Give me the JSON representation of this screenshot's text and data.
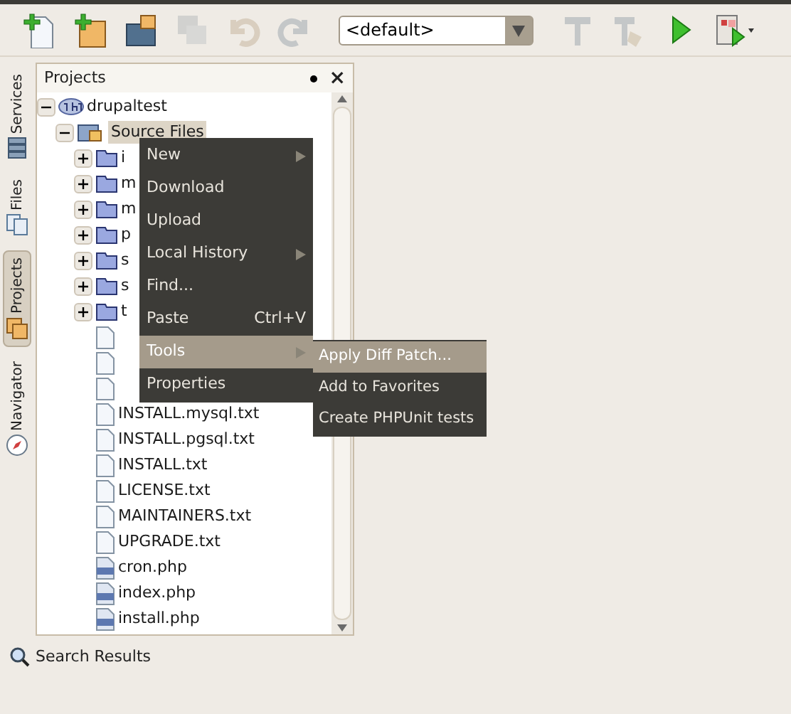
{
  "toolbar": [
    {
      "kind": "new-file",
      "disabled": false
    },
    {
      "kind": "new-project",
      "disabled": false
    },
    {
      "kind": "open-project",
      "disabled": false
    },
    {
      "kind": "save-all",
      "disabled": true
    },
    {
      "kind": "undo",
      "disabled": true
    },
    {
      "kind": "redo",
      "disabled": true
    },
    {
      "kind": "config",
      "value": "<default>"
    },
    {
      "kind": "build",
      "disabled": true
    },
    {
      "kind": "clean-build",
      "disabled": true
    },
    {
      "kind": "run",
      "disabled": false
    },
    {
      "kind": "test",
      "disabled": false
    }
  ],
  "side_tabs": [
    {
      "label": "Services",
      "kind": "services",
      "selected": false
    },
    {
      "label": "Files",
      "kind": "files",
      "selected": false
    },
    {
      "label": "Projects",
      "kind": "projects",
      "selected": true
    },
    {
      "label": "Navigator",
      "kind": "navigator",
      "selected": false
    }
  ],
  "projects": {
    "title": "Projects",
    "close": "×",
    "tree": [
      {
        "label": "drupaltest",
        "kind": "project",
        "expanded": true,
        "children": [
          {
            "label": "Source Files",
            "kind": "source",
            "expanded": true,
            "selected": true,
            "children": [
              {
                "label": "i",
                "kind": "folder",
                "expanded": false
              },
              {
                "label": "m",
                "kind": "folder",
                "expanded": false
              },
              {
                "label": "m",
                "kind": "folder",
                "expanded": false
              },
              {
                "label": "p",
                "kind": "folder",
                "expanded": false
              },
              {
                "label": "s",
                "kind": "folder",
                "expanded": false
              },
              {
                "label": "s",
                "kind": "folder",
                "expanded": false
              },
              {
                "label": "t",
                "kind": "folder",
                "expanded": false
              },
              {
                "kind": "text"
              },
              {
                "kind": "text"
              },
              {
                "kind": "text"
              },
              {
                "label": "INSTALL.mysql.txt",
                "kind": "text"
              },
              {
                "label": "INSTALL.pgsql.txt",
                "kind": "text"
              },
              {
                "label": "INSTALL.txt",
                "kind": "text"
              },
              {
                "label": "LICENSE.txt",
                "kind": "text"
              },
              {
                "label": "MAINTAINERS.txt",
                "kind": "text"
              },
              {
                "label": "UPGRADE.txt",
                "kind": "text"
              },
              {
                "label": "cron.php",
                "kind": "php"
              },
              {
                "label": "index.php",
                "kind": "php"
              },
              {
                "label": "install.php",
                "kind": "php"
              }
            ]
          }
        ]
      }
    ]
  },
  "context_menu": [
    {
      "label": "New",
      "submenu": true,
      "selected": false
    },
    {
      "label": "Download",
      "submenu": false,
      "selected": false
    },
    {
      "label": "Upload",
      "submenu": false,
      "selected": false
    },
    {
      "label": "Local History",
      "submenu": true,
      "selected": false
    },
    {
      "label": "Find...",
      "submenu": false,
      "selected": false
    },
    {
      "label": "Paste",
      "shortcut": "Ctrl+V",
      "submenu": false,
      "selected": false
    },
    {
      "label": "Tools",
      "submenu": true,
      "selected": true
    },
    {
      "label": "Properties",
      "submenu": false,
      "selected": false
    }
  ],
  "submenu": [
    {
      "label": "Apply Diff Patch...",
      "selected": true
    },
    {
      "label": "Add to Favorites",
      "selected": false
    },
    {
      "label": "Create PHPUnit tests",
      "selected": false
    }
  ],
  "bottom_tab": {
    "label": "Search Results"
  }
}
